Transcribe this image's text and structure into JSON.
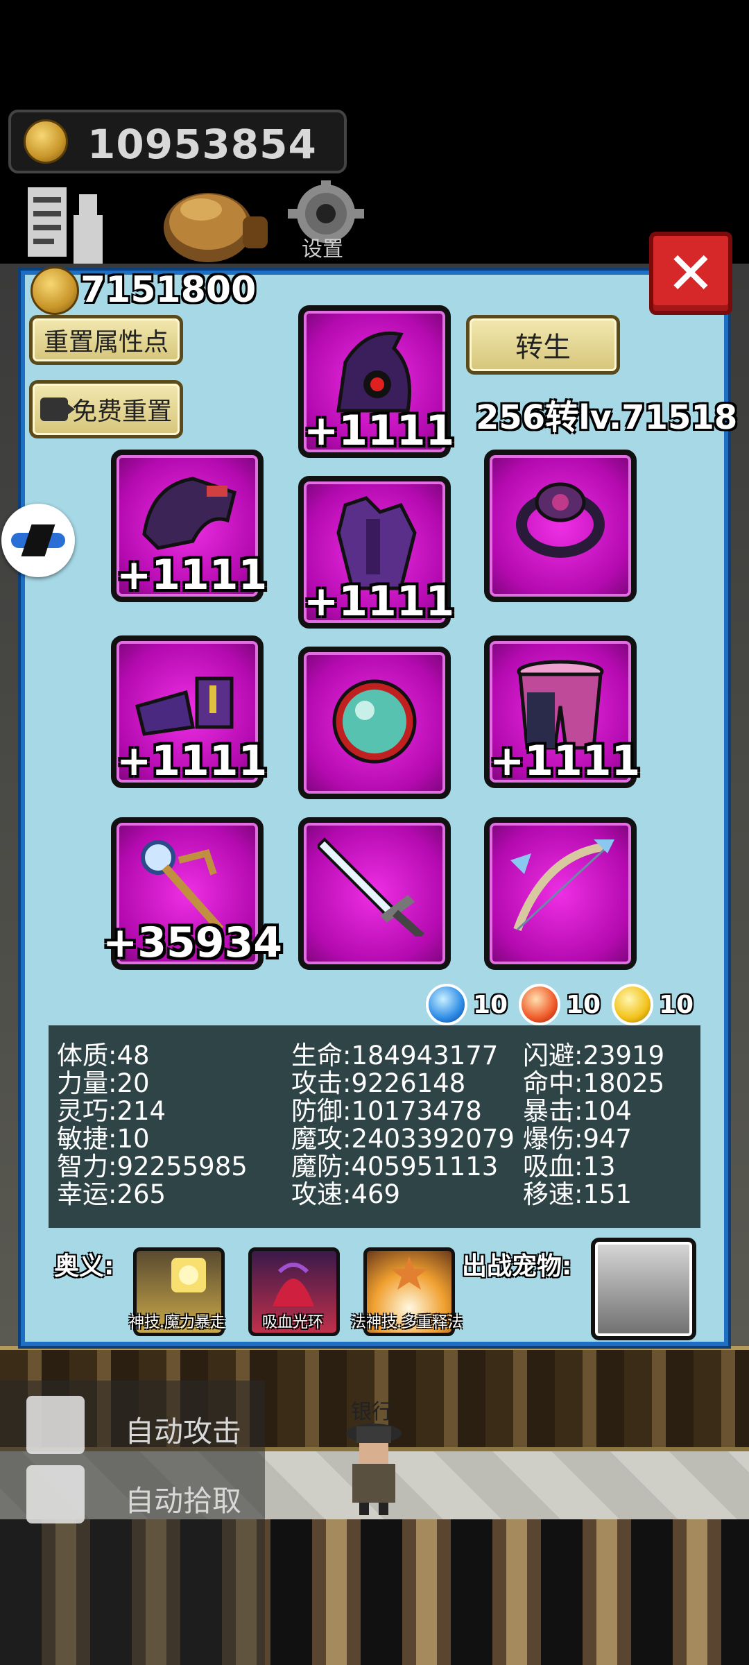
{
  "top_bar": {
    "gold": "10953854",
    "settings_label": "设置"
  },
  "panel": {
    "gold": "7151800",
    "reset_attr_label": "重置属性点",
    "free_reset_label": "免费重置",
    "rebirth_label": "转生",
    "rebirth_level": "256转lv.71518",
    "close_label": "✕"
  },
  "equipment": {
    "helmet": "+1111",
    "gloves": "+1111",
    "armor": "+1111",
    "ring": "",
    "boots": "+1111",
    "amulet": "",
    "pants": "+1111",
    "staff": "+35934",
    "sword": "",
    "bow": ""
  },
  "gems": {
    "water": "10",
    "fire": "10",
    "lightning": "10"
  },
  "stats": {
    "col1": [
      "体质:48",
      "力量:20",
      "灵巧:214",
      "敏捷:10",
      "智力:92255985",
      "幸运:265"
    ],
    "col2": [
      "生命:184943177",
      "攻击:9226148",
      "防御:10173478",
      "魔攻:2403392079",
      "魔防:405951113",
      "攻速:469"
    ],
    "col3": [
      "闪避:23919",
      "命中:18025",
      "暴击:104",
      "爆伤:947",
      "吸血:13",
      "移速:151"
    ]
  },
  "skills": {
    "label": "奥义:",
    "items": [
      "神技.魔力暴走",
      "吸血光环",
      "法神技.多重释法"
    ],
    "pet_label": "出战宠物:"
  },
  "bottom": {
    "auto_attack": "自动攻击",
    "auto_pickup": "自动拾取",
    "bank_label": "银行"
  },
  "colors": {
    "panel_bg": "#a6d8e6",
    "panel_border": "#1e6fc4",
    "slot_magenta": "#d21ccd",
    "close_red": "#d62828",
    "stats_bg": "#2f4447"
  }
}
